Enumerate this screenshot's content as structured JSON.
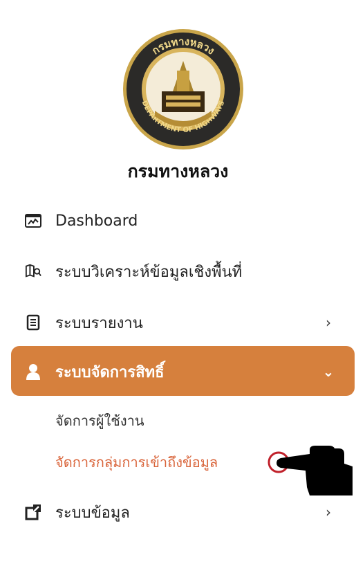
{
  "brand": {
    "name": "กรมทางหลวง",
    "seal_text_top": "กรมทางหลวง",
    "seal_text_bottom": "DEPARTMENT OF HIGHWAYS"
  },
  "menu": {
    "dashboard": {
      "label": "Dashboard",
      "icon": "dashboard-icon"
    },
    "spatial": {
      "label": "ระบบวิเคราะห์ข้อมูลเชิงพื้นที่",
      "icon": "map-search-icon"
    },
    "reports": {
      "label": "ระบบรายงาน",
      "icon": "document-icon",
      "chevron": "›"
    },
    "permissions": {
      "label": "ระบบจัดการสิทธิ์",
      "icon": "user-icon",
      "chevron": "⌄",
      "sub_items": [
        {
          "label": "จัดการผู้ใช้งาน"
        },
        {
          "label": "จัดการกลุ่มการเข้าถึงข้อมูล"
        }
      ]
    },
    "data": {
      "label": "ระบบข้อมูล",
      "icon": "external-link-icon",
      "chevron": "›"
    }
  },
  "colors": {
    "accent": "#d6803d",
    "selected_text": "#d9643a",
    "cursor_ring": "#c0202a"
  }
}
